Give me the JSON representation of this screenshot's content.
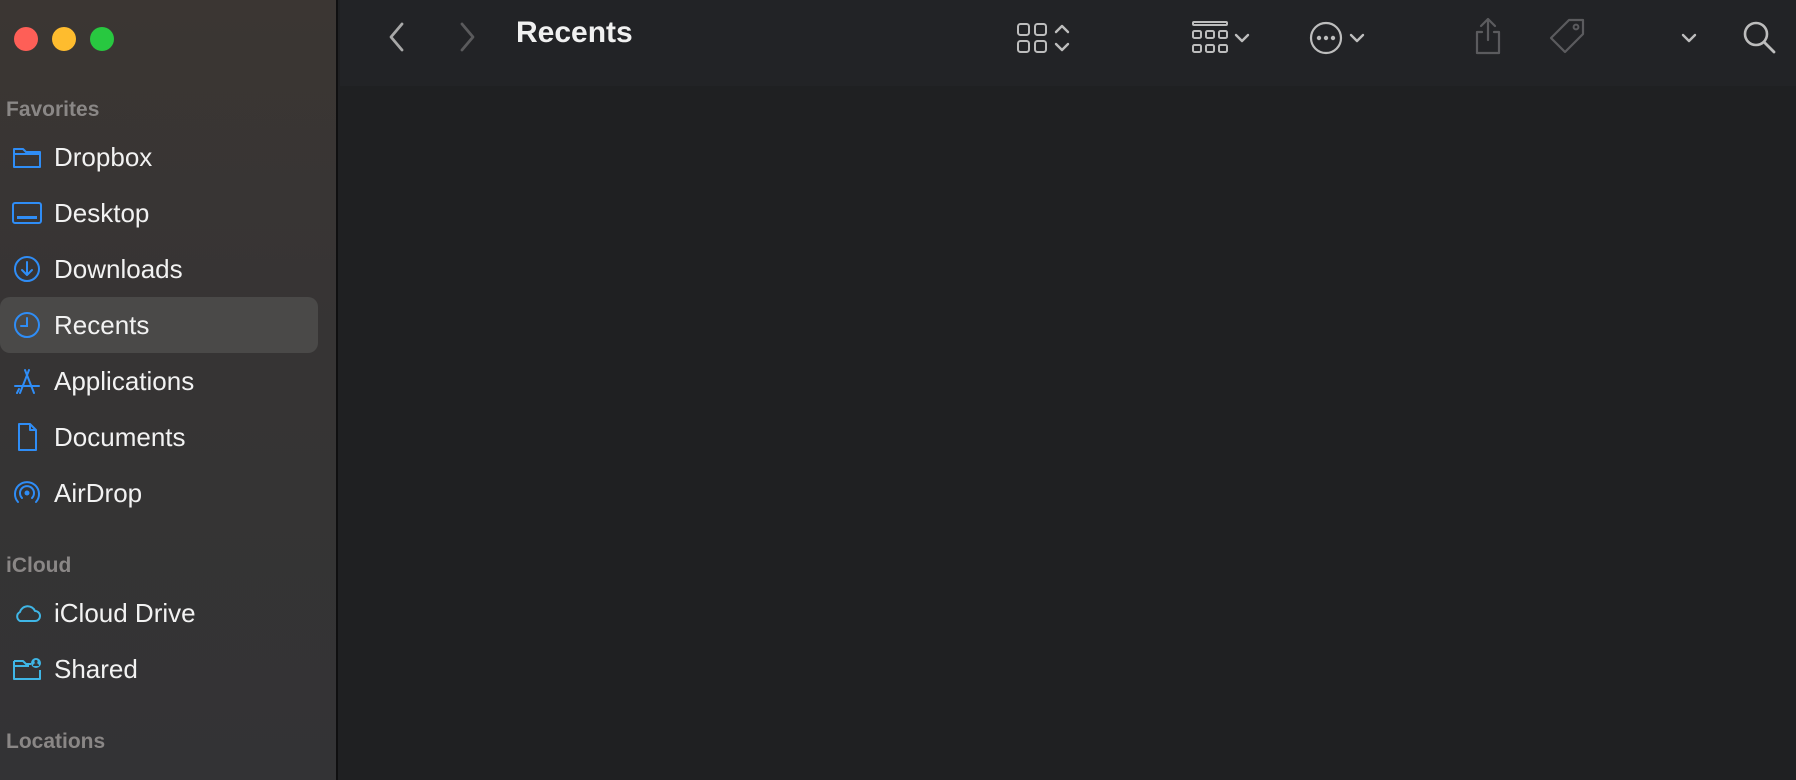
{
  "window": {
    "title": "Recents",
    "traffic_lights": {
      "close": "#fe5f57",
      "minimize": "#febc2e",
      "maximize": "#28c840"
    }
  },
  "toolbar": {
    "back_icon": "chevron-left-icon",
    "forward_icon": "chevron-right-icon",
    "view_icon": "grid-view-icon",
    "group_icon": "group-by-icon",
    "action_icon": "ellipsis-circle-icon",
    "share_icon": "share-icon",
    "tag_icon": "tag-icon",
    "more_icon": "chevron-down-icon",
    "search_icon": "search-icon"
  },
  "sidebar": {
    "sections": [
      {
        "title": "Favorites",
        "items": [
          {
            "label": "Dropbox",
            "icon": "folder-icon"
          },
          {
            "label": "Desktop",
            "icon": "desktop-icon"
          },
          {
            "label": "Downloads",
            "icon": "downloads-icon"
          },
          {
            "label": "Recents",
            "icon": "clock-icon",
            "selected": true
          },
          {
            "label": "Applications",
            "icon": "applications-icon"
          },
          {
            "label": "Documents",
            "icon": "document-icon"
          },
          {
            "label": "AirDrop",
            "icon": "airdrop-icon"
          }
        ]
      },
      {
        "title": "iCloud",
        "items": [
          {
            "label": "iCloud Drive",
            "icon": "cloud-icon"
          },
          {
            "label": "Shared",
            "icon": "shared-folder-icon"
          }
        ]
      },
      {
        "title": "Locations",
        "items": []
      }
    ]
  },
  "colors": {
    "accent": "#2f8df6",
    "icloud_accent": "#3fb6e6",
    "sidebar_selected": "#4a4948",
    "content_bg": "#1f2022"
  }
}
